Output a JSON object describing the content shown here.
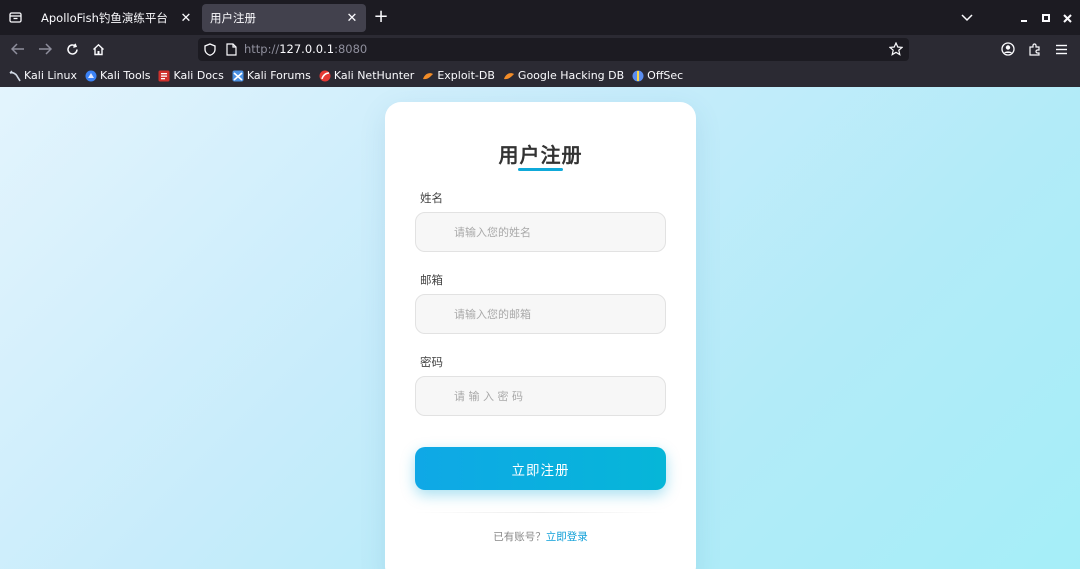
{
  "browser": {
    "tabs": [
      {
        "label": "ApolloFish钓鱼演练平台",
        "active": false
      },
      {
        "label": "用户注册",
        "active": true
      }
    ],
    "new_tab_glyph": "+",
    "url": {
      "scheme": "http://",
      "host": "127.0.0.1",
      "port": ":8080"
    },
    "icons": {
      "tab_list": "tab-list-icon",
      "back": "back-arrow-icon",
      "forward": "forward-arrow-icon",
      "reload": "reload-icon",
      "home": "home-icon",
      "shield": "tracking-shield-icon",
      "page": "page-icon",
      "star": "bookmark-star-icon",
      "account": "account-icon",
      "extensions": "extensions-icon",
      "menu": "hamburger-menu-icon"
    },
    "bookmarks": [
      {
        "label": "Kali Linux",
        "icon": "kali-dragon-icon",
        "color": "#cfd8e3"
      },
      {
        "label": "Kali Tools",
        "icon": "kali-tools-icon",
        "color": "#3b82f6"
      },
      {
        "label": "Kali Docs",
        "icon": "kali-docs-icon",
        "color": "#d0312d"
      },
      {
        "label": "Kali Forums",
        "icon": "kali-forums-icon",
        "color": "#4a90e2"
      },
      {
        "label": "Kali NetHunter",
        "icon": "nethunter-icon",
        "color": "#e53935"
      },
      {
        "label": "Exploit-DB",
        "icon": "exploit-db-icon",
        "color": "#f28c28"
      },
      {
        "label": "Google Hacking DB",
        "icon": "ghdb-icon",
        "color": "#f28c28"
      },
      {
        "label": "OffSec",
        "icon": "offsec-icon",
        "color": "#5b8def"
      }
    ]
  },
  "form": {
    "title": "用户注册",
    "accent_color": "#0fa9d9",
    "fields": [
      {
        "label": "姓名",
        "placeholder": "请输入您的姓名",
        "value": ""
      },
      {
        "label": "邮箱",
        "placeholder": "请输入您的邮箱",
        "value": ""
      },
      {
        "label": "密码",
        "placeholder": "请 输 入 密 码",
        "value": ""
      }
    ],
    "submit_label": "立即注册",
    "footer_text": "已有账号？",
    "login_link": "立即登录"
  }
}
